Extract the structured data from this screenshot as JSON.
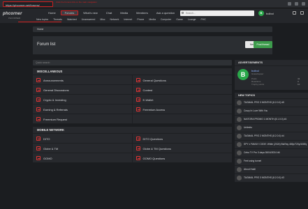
{
  "browser": {
    "url": "https://phcorner.net/forums/",
    "annotation": "Click the Forums link on the main navigation"
  },
  "header": {
    "logo_title": "phcorner",
    "logo_subtitle": "PHCORNER",
    "nav": [
      "Home",
      "Forums",
      "What's new",
      "Chat",
      "Media",
      "Members",
      "Ask a question"
    ],
    "search_placeholder": "Search...",
    "user_initial": "B",
    "username": "bolbol",
    "subnav": [
      "New topics",
      "Threads",
      "Watched",
      "Unanswered",
      "Misc",
      "Network",
      "Internet",
      "Phone",
      "Media",
      "Computer",
      "Game",
      "Lounge",
      "PHC"
    ]
  },
  "breadcrumb": "Home",
  "page": {
    "title": "Forum list",
    "new_posts": "New posts",
    "post_thread": "Post thread"
  },
  "quick_search": "Quick search",
  "categories": [
    {
      "name": "MISCELLANEOUS",
      "forums": [
        "Announcements",
        "General Questions",
        "General Discussions",
        "Contest",
        "Crypto & Investing",
        "E-Wallet",
        "Earning & Referrals",
        "Freemium Access",
        "Freemium Request"
      ]
    },
    {
      "name": "MOBILE NETWORK",
      "forums": [
        "DITO",
        "DITO Questions",
        "Globe & TM",
        "Globe & TM Questions",
        "GOMO",
        "GOMO Questions"
      ]
    }
  ],
  "sidebar": {
    "advertisements_title": "ADVERTISEMENTS",
    "profile": {
      "initial": "B",
      "name": "bolbol",
      "role": "Grasshopper",
      "stats": [
        {
          "label": "Posts",
          "value": "41"
        },
        {
          "label": "Reactions",
          "value": "3"
        },
        {
          "label": "Trophy points",
          "value": "10"
        }
      ]
    },
    "new_topics_title": "NEW TOPICS",
    "topics": [
      "TAGMAIL PRO 3 MONTHS (8.2.0.0) #5",
      "Crazy In Love With You",
      "NAITORA PROMO 1 MONTH (8.1.0.0) #4",
      "Unlimito",
      "TAGMAIL PRO 2 MONTHS (8.2.0.0) #4",
      "SPY x FAMILY CODE: White (2024) BluRay 480p/720p/1080p English",
      "Cebu TV Pro 3 days 08/04/2024 #6",
      "Feel using tunnel",
      "About Hakli",
      "TAGMAIL PRO 3 MONTHS (8.2.0.0) #3"
    ]
  },
  "colors": {
    "accent": "#d02020",
    "green": "#2aa84a"
  }
}
